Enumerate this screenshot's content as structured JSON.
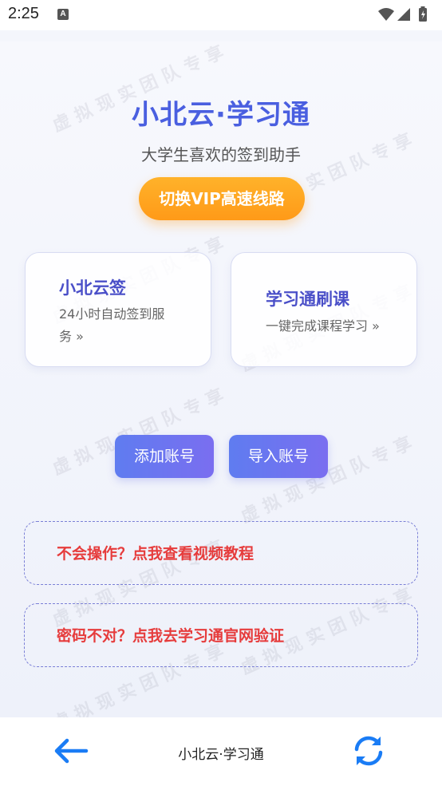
{
  "status_bar": {
    "time": "2:25",
    "notification_icon": "A"
  },
  "header": {
    "title": "小北云·学习通",
    "subtitle": "大学生喜欢的签到助手",
    "vip_button_label": "切换VIP高速线路"
  },
  "cards": {
    "left": {
      "title": "小北云签",
      "desc_line1": "24小时自动签到服",
      "desc_line2": "务 »"
    },
    "right": {
      "title": "学习通刷课",
      "desc": "一键完成课程学习 »"
    }
  },
  "account_buttons": {
    "add_label": "添加账号",
    "import_label": "导入账号"
  },
  "help_links": {
    "video_tutorial": "不会操作？点我查看视频教程",
    "password_check": "密码不对？点我去学习通官网验证"
  },
  "watermark": {
    "text": "虚拟现实团队专享"
  },
  "bottom_bar": {
    "title": "小北云·学习通",
    "back_icon": "arrow-left-icon",
    "refresh_icon": "refresh-icon"
  },
  "colors": {
    "title": "#4a5fe0",
    "vip_orange": "#ff9a18",
    "card_title": "#4a4fc8",
    "button_blue": "#6a75f0",
    "help_red": "#e63c3c",
    "nav_icon_blue": "#1a7cf5"
  }
}
